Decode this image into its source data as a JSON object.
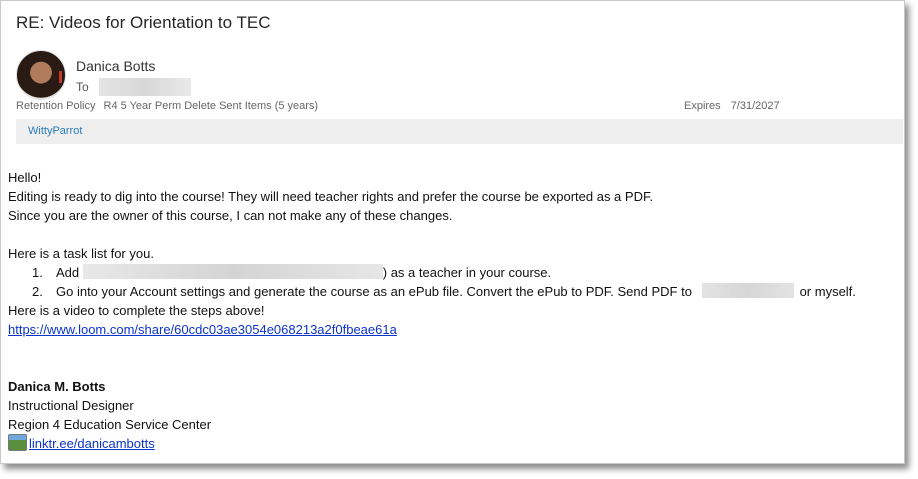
{
  "email": {
    "subject": "RE: Videos for Orientation to TEC",
    "sender": "Danica Botts",
    "to_label": "To",
    "retention_label": "Retention Policy",
    "retention_value": "R4 5 Year Perm Delete Sent Items (5 years)",
    "expires_label": "Expires",
    "expires_value": "7/31/2027",
    "addin_label": "WittyParrot"
  },
  "body": {
    "greeting": "Hello!",
    "line1": "Editing is ready to dig into the course! They will need teacher rights and prefer the course be exported as a PDF.",
    "line2": "Since you are the owner of this course, I can not make any of these changes.",
    "task_intro": "Here is a task list for you.",
    "task1_num": "1.",
    "task1_prefix": "Add",
    "task1_suffix": ") as a teacher in your course.",
    "task2_num": "2.",
    "task2_prefix": "Go into your Account settings and generate the course as an ePub file. Convert the ePub to PDF. Send PDF to",
    "task2_suffix": "or myself.",
    "video_line": "Here is a video to complete the steps above!",
    "video_link": "https://www.loom.com/share/60cdc03ae3054e068213a2f0fbeae61a"
  },
  "signature": {
    "name": "Danica M. Botts",
    "title": "Instructional Designer",
    "org": "Region 4 Education Service Center",
    "link": "linktr.ee/danicambotts",
    "link_icon": "linktree-image-icon"
  }
}
